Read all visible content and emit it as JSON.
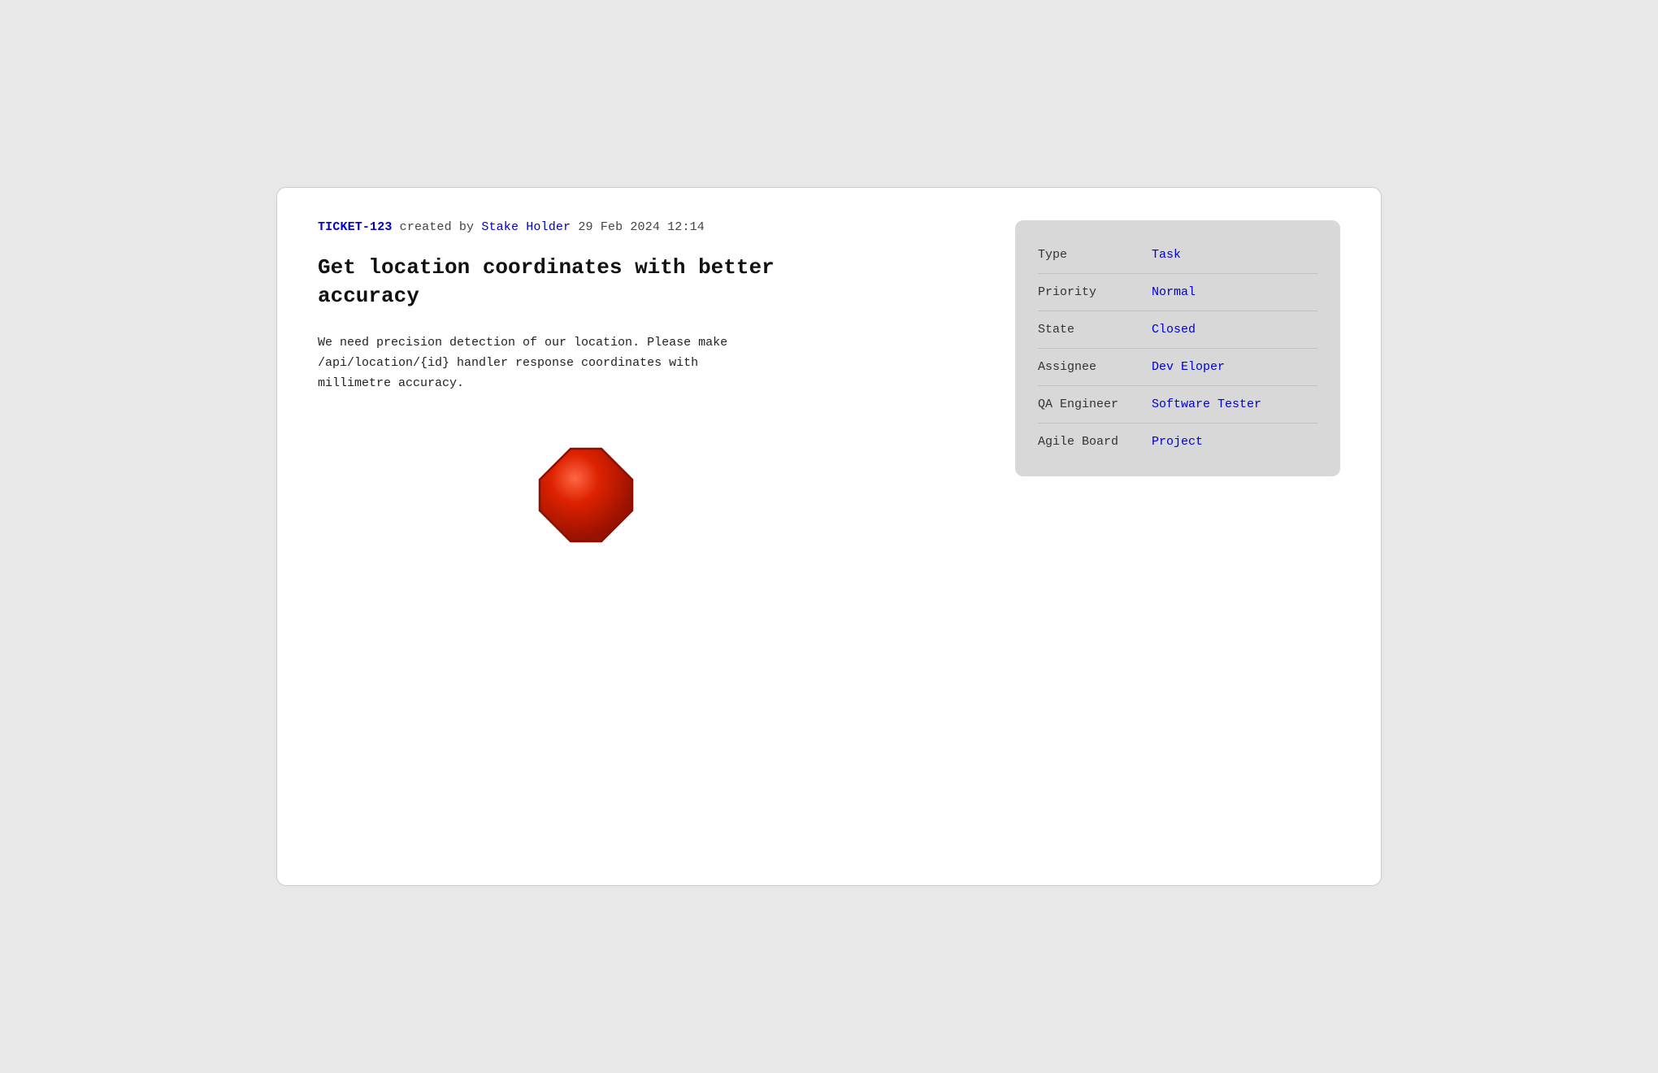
{
  "ticket": {
    "id": "TICKET-123",
    "created_by_prefix": "created by",
    "author": "Stake Holder",
    "date": "29 Feb 2024 12:14",
    "title": "Get location coordinates with better accuracy",
    "description": "We need precision detection of our location. Please make\n/api/location/{id} handler response coordinates with\nmillimetre accuracy."
  },
  "sidebar": {
    "fields": [
      {
        "label": "Type",
        "value": "Task"
      },
      {
        "label": "Priority",
        "value": "Normal"
      },
      {
        "label": "State",
        "value": "Closed"
      },
      {
        "label": "Assignee",
        "value": "Dev Eloper"
      },
      {
        "label": "QA Engineer",
        "value": "Software Tester"
      },
      {
        "label": "Agile Board",
        "value": "Project"
      }
    ]
  }
}
